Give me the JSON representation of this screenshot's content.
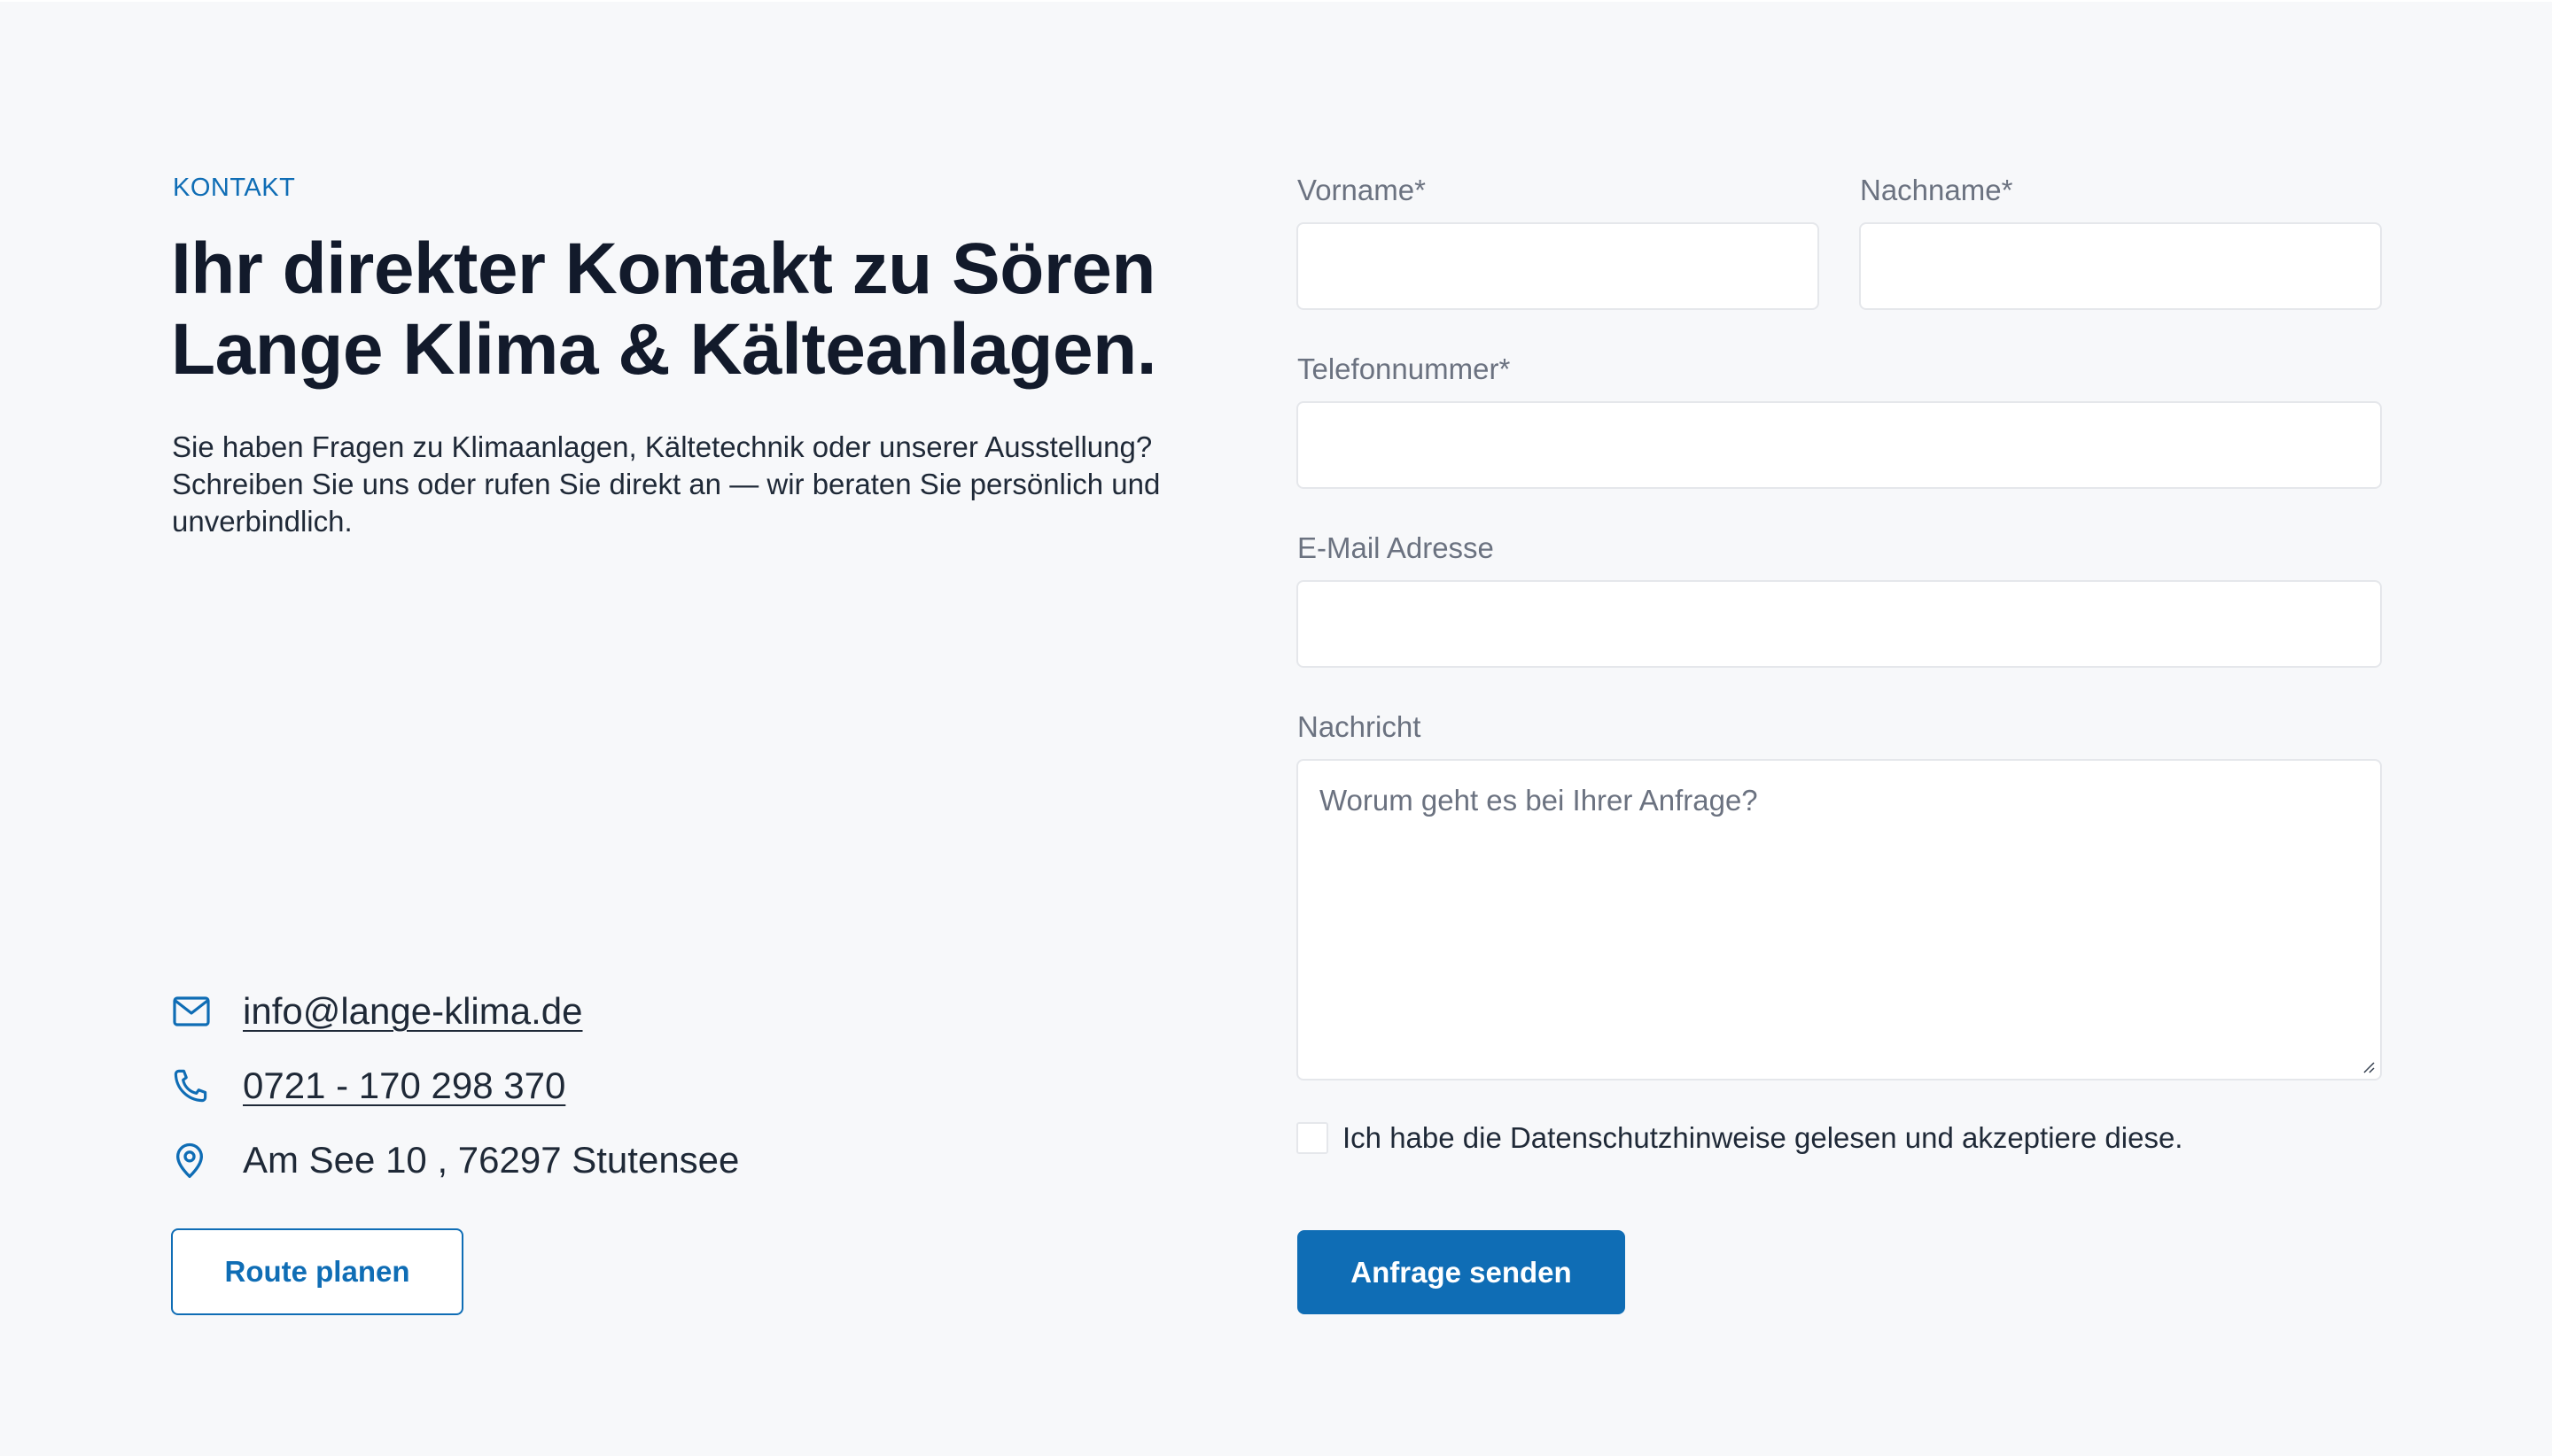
{
  "contact": {
    "eyebrow": "KONTAKT",
    "headline_line1": "Ihr direkter Kontakt zu Sören",
    "headline_line2": "Lange Klima & Kälteanlagen.",
    "intro": "Sie haben Fragen zu Klimaanlagen, Kältetechnik oder unserer Ausstellung? Schreiben Sie uns oder rufen Sie direkt an — wir beraten Sie persönlich und unverbindlich.",
    "email": "info@lange-klima.de",
    "phone": "0721 - 170 298 370",
    "address": "Am See 10 , 76297 Stutensee",
    "route_button": "Route planen",
    "icons": [
      "mail-icon",
      "phone-icon",
      "map-pin-icon"
    ]
  },
  "form": {
    "first_name_label": "Vorname*",
    "last_name_label": "Nachname*",
    "phone_label": "Telefonnummer*",
    "email_label": "E-Mail Adresse",
    "message_label": "Nachricht",
    "message_placeholder": "Worum geht es bei Ihrer Anfrage?",
    "consent_text": "Ich habe die Datenschutzhinweise gelesen und akzeptiere diese.",
    "consent_checked": false,
    "submit_label": "Anfrage senden"
  },
  "colors": {
    "accent": "#0f6db5",
    "background": "#f7f8fa",
    "heading": "#121a2b",
    "label": "#6b7280",
    "field_border": "#e5e7eb"
  }
}
